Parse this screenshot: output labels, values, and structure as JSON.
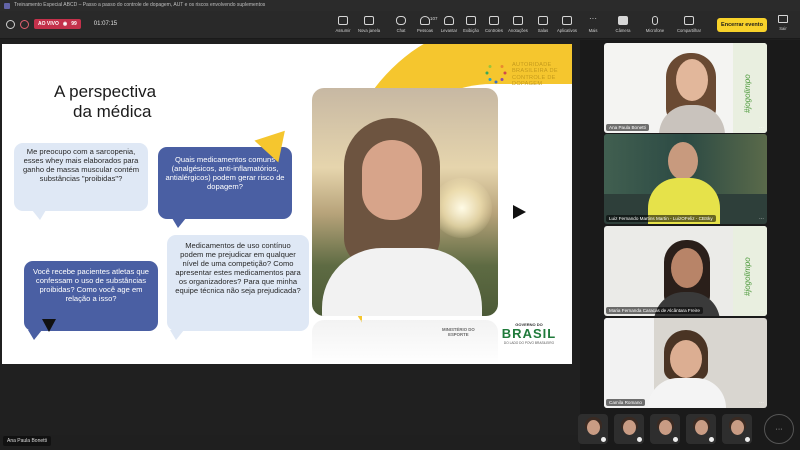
{
  "window": {
    "title": "Treinamento Especial ABCD – Passo a passo do controle de dopagem, AUT e os riscos envolvendo suplementos"
  },
  "toolbar": {
    "live_label": "AO VIVO",
    "live_viewers": "99",
    "timer": "01:07:15",
    "buttons": [
      {
        "id": "assumir",
        "label": "Assumir"
      },
      {
        "id": "nova-janela",
        "label": "Nova janela"
      },
      {
        "id": "chat",
        "label": "Chat"
      },
      {
        "id": "pessoas",
        "label": "Pessoas",
        "count": "107"
      },
      {
        "id": "levantar",
        "label": "Levantar"
      },
      {
        "id": "exibicao",
        "label": "Exibição"
      },
      {
        "id": "controles",
        "label": "Controles"
      },
      {
        "id": "anotacoes",
        "label": "Anotações"
      },
      {
        "id": "salas",
        "label": "Salas"
      },
      {
        "id": "aplicativos",
        "label": "Aplicativos"
      },
      {
        "id": "mais",
        "label": "Mais"
      },
      {
        "id": "camera",
        "label": "Câmera"
      },
      {
        "id": "microfone",
        "label": "Microfone"
      },
      {
        "id": "compartilhar",
        "label": "Compartilhar"
      }
    ],
    "end_event_label": "Encerrar evento",
    "exit_label": "Sair"
  },
  "slide": {
    "title_line1": "A perspectiva",
    "title_line2": "da médica",
    "bubbles": [
      {
        "text": "Me preocupo com a sarcopenia, esses whey mais elaborados para ganho de massa muscular contém substâncias \"proibidas\"?"
      },
      {
        "text": "Quais medicamentos comuns (analgésicos, anti-inflamatórios, antialérgicos) podem gerar risco de dopagem?"
      },
      {
        "text": "Você recebe pacientes atletas que confessam o uso de substâncias proibidas? Como você age em relação a isso?"
      },
      {
        "text": "Medicamentos de uso contínuo podem me prejudicar em qualquer nível de uma competição? Como apresentar estes medicamentos para os organizadores? Para que minha equipe técnica não seja prejudicada?"
      }
    ],
    "org_line1": "AUTORIDADE",
    "org_line2": "BRASILEIRA DE",
    "org_line3": "CONTROLE DE",
    "org_line4": "DOPAGEM",
    "ministry_line1": "MINISTÉRIO DO",
    "ministry_line2": "ESPORTE",
    "gov_label": "GOVERNO DO",
    "brasil_word": "BRASIL",
    "brasil_sub": "DO LADO DO POVO BRASILEIRO",
    "colors": {
      "accent_yellow": "#f5c62e",
      "bubble_dark": "#4a5fa3",
      "bubble_light": "#dfe8f5"
    }
  },
  "presenter": {
    "name": "Ana Paula Bonetti"
  },
  "participants": [
    {
      "name": "Ana Paula Bonetti",
      "banner": "#jogolimpo"
    },
    {
      "name": "Luiz Fernando Martins Martin - LuizOFeliz - CBSky"
    },
    {
      "name": "Maria Fernanda Caracas de Alcântara Freire",
      "banner": "#jogolimpo"
    },
    {
      "name": "Camila Romano"
    }
  ],
  "more_label": "···"
}
